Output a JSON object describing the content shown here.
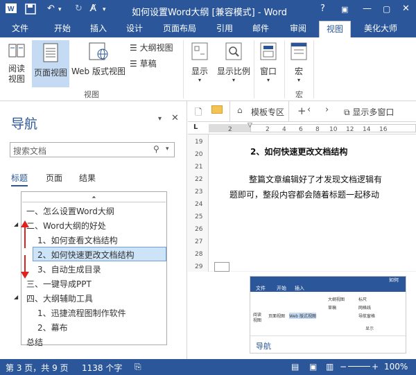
{
  "window": {
    "title": "如何设置Word大纲 [兼容模式] - Word",
    "help": "?"
  },
  "tabs": [
    "文件",
    "开始",
    "插入",
    "设计",
    "页面布局",
    "引用",
    "邮件",
    "审阅",
    "视图",
    "美化大师"
  ],
  "ribbon": {
    "views": [
      "阅读\n视图",
      "页面视图",
      "Web 版式视图"
    ],
    "small_views": [
      "大纲视图",
      "草稿"
    ],
    "group_view": "视图",
    "show": "显示",
    "zoom": "显示比例",
    "window": "窗口",
    "macro": "宏",
    "group_macro": "宏"
  },
  "nav": {
    "title": "导航",
    "search_placeholder": "搜索文档",
    "tabs": [
      "标题",
      "页面",
      "结果"
    ],
    "items": [
      {
        "text": "一、怎么设置Word大纲"
      },
      {
        "text": "二、Word大纲的好处"
      },
      {
        "text": "1、如何查看文档结构"
      },
      {
        "text": "2、如何快速更改文档结构"
      },
      {
        "text": "3、自动生成目录"
      },
      {
        "text": "三、一键导成PPT"
      },
      {
        "text": "四、大纲辅助工具"
      },
      {
        "text": "1、迅捷流程图制作软件"
      },
      {
        "text": "2、幕布"
      },
      {
        "text": "总结"
      }
    ]
  },
  "doc_tabs": {
    "template": "模板专区",
    "multi": "显示多窗口"
  },
  "ruler_marks": [
    "2",
    "2",
    "4",
    "6",
    "8",
    "10",
    "12",
    "14",
    "16"
  ],
  "vruler_marks": [
    "19",
    "20",
    "21",
    "22",
    "23",
    "24",
    "25",
    "26",
    "27",
    "28",
    "29"
  ],
  "doc": {
    "heading": "2、如何快速更改文档结构",
    "para1": "整篇文章编辑好了才发现文档逻辑有",
    "para2": "题即可，整段内容都会随着标题一起移动"
  },
  "thumbnail": {
    "title": "如何",
    "tabs": [
      "文件",
      "开始",
      "插入"
    ],
    "labels": [
      "阅读\n视图",
      "页面视图",
      "Web 版式视图"
    ],
    "small": [
      "大纲视图",
      "草稿"
    ],
    "checks": [
      "标尺",
      "网格线",
      "导航窗格"
    ],
    "show": "显示",
    "nav": "导航"
  },
  "status": {
    "page": "第 3 页，共 9 页",
    "words": "1138 个字",
    "zoom": "100%"
  },
  "colors": {
    "accent": "#2b579a",
    "selected": "#c5daf3",
    "arrow": "#e02020"
  }
}
